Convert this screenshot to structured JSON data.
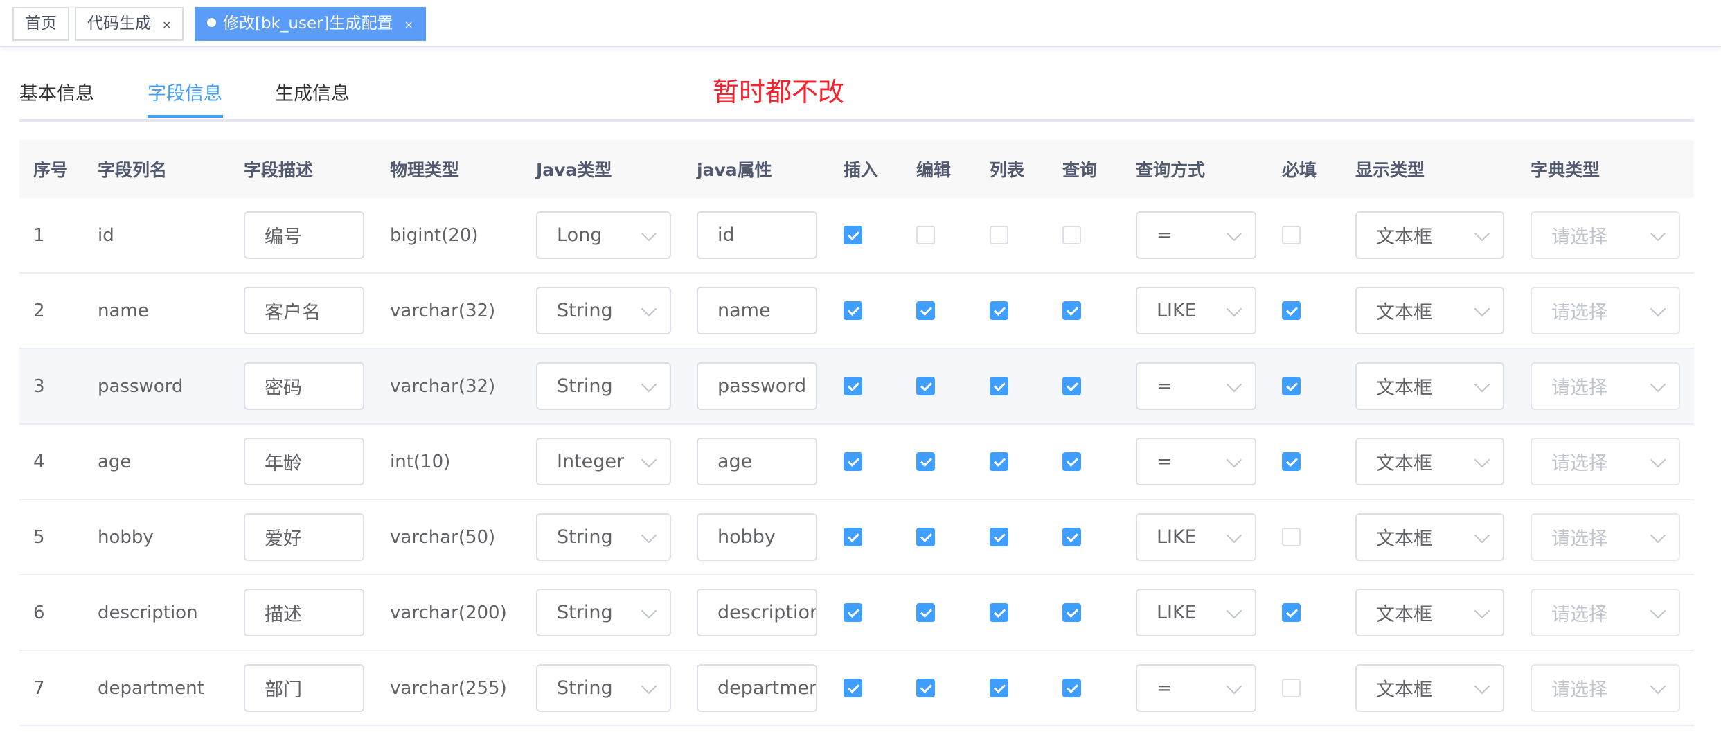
{
  "tags": [
    {
      "label": "首页",
      "closable": false,
      "active": false
    },
    {
      "label": "代码生成",
      "closable": true,
      "active": false
    },
    {
      "label": "修改[bk_user]生成配置",
      "closable": true,
      "active": true
    }
  ],
  "tag_close_glyph": "×",
  "tabs": [
    {
      "label": "基本信息",
      "active": false
    },
    {
      "label": "字段信息",
      "active": true
    },
    {
      "label": "生成信息",
      "active": false
    }
  ],
  "annotation": "暂时都不改",
  "columns": {
    "index": "序号",
    "column_name": "字段列名",
    "description": "字段描述",
    "physical_type": "物理类型",
    "java_type": "Java类型",
    "java_field": "java属性",
    "insert": "插入",
    "edit": "编辑",
    "list": "列表",
    "query": "查询",
    "query_type": "查询方式",
    "required": "必填",
    "display_type": "显示类型",
    "dict_type": "字典类型"
  },
  "dict_placeholder": "请选择",
  "rows": [
    {
      "index": "1",
      "column_name": "id",
      "description": "编号",
      "physical_type": "bigint(20)",
      "java_type": "Long",
      "java_field": "id",
      "insert": true,
      "edit": false,
      "list": false,
      "query": false,
      "query_type": "=",
      "required": false,
      "display_type": "文本框"
    },
    {
      "index": "2",
      "column_name": "name",
      "description": "客户名",
      "physical_type": "varchar(32)",
      "java_type": "String",
      "java_field": "name",
      "insert": true,
      "edit": true,
      "list": true,
      "query": true,
      "query_type": "LIKE",
      "required": true,
      "display_type": "文本框"
    },
    {
      "index": "3",
      "column_name": "password",
      "description": "密码",
      "physical_type": "varchar(32)",
      "java_type": "String",
      "java_field": "password",
      "insert": true,
      "edit": true,
      "list": true,
      "query": true,
      "query_type": "=",
      "required": true,
      "display_type": "文本框"
    },
    {
      "index": "4",
      "column_name": "age",
      "description": "年龄",
      "physical_type": "int(10)",
      "java_type": "Integer",
      "java_field": "age",
      "insert": true,
      "edit": true,
      "list": true,
      "query": true,
      "query_type": "=",
      "required": true,
      "display_type": "文本框"
    },
    {
      "index": "5",
      "column_name": "hobby",
      "description": "爱好",
      "physical_type": "varchar(50)",
      "java_type": "String",
      "java_field": "hobby",
      "insert": true,
      "edit": true,
      "list": true,
      "query": true,
      "query_type": "LIKE",
      "required": false,
      "display_type": "文本框"
    },
    {
      "index": "6",
      "column_name": "description",
      "description": "描述",
      "physical_type": "varchar(200)",
      "java_type": "String",
      "java_field": "description",
      "insert": true,
      "edit": true,
      "list": true,
      "query": true,
      "query_type": "LIKE",
      "required": true,
      "display_type": "文本框"
    },
    {
      "index": "7",
      "column_name": "department",
      "description": "部门",
      "physical_type": "varchar(255)",
      "java_type": "String",
      "java_field": "department",
      "insert": true,
      "edit": true,
      "list": true,
      "query": true,
      "query_type": "=",
      "required": false,
      "display_type": "文本框"
    }
  ],
  "colors": {
    "primary": "#409eff",
    "annotation": "#f5222d",
    "active_tag": "#5a9cf8"
  }
}
